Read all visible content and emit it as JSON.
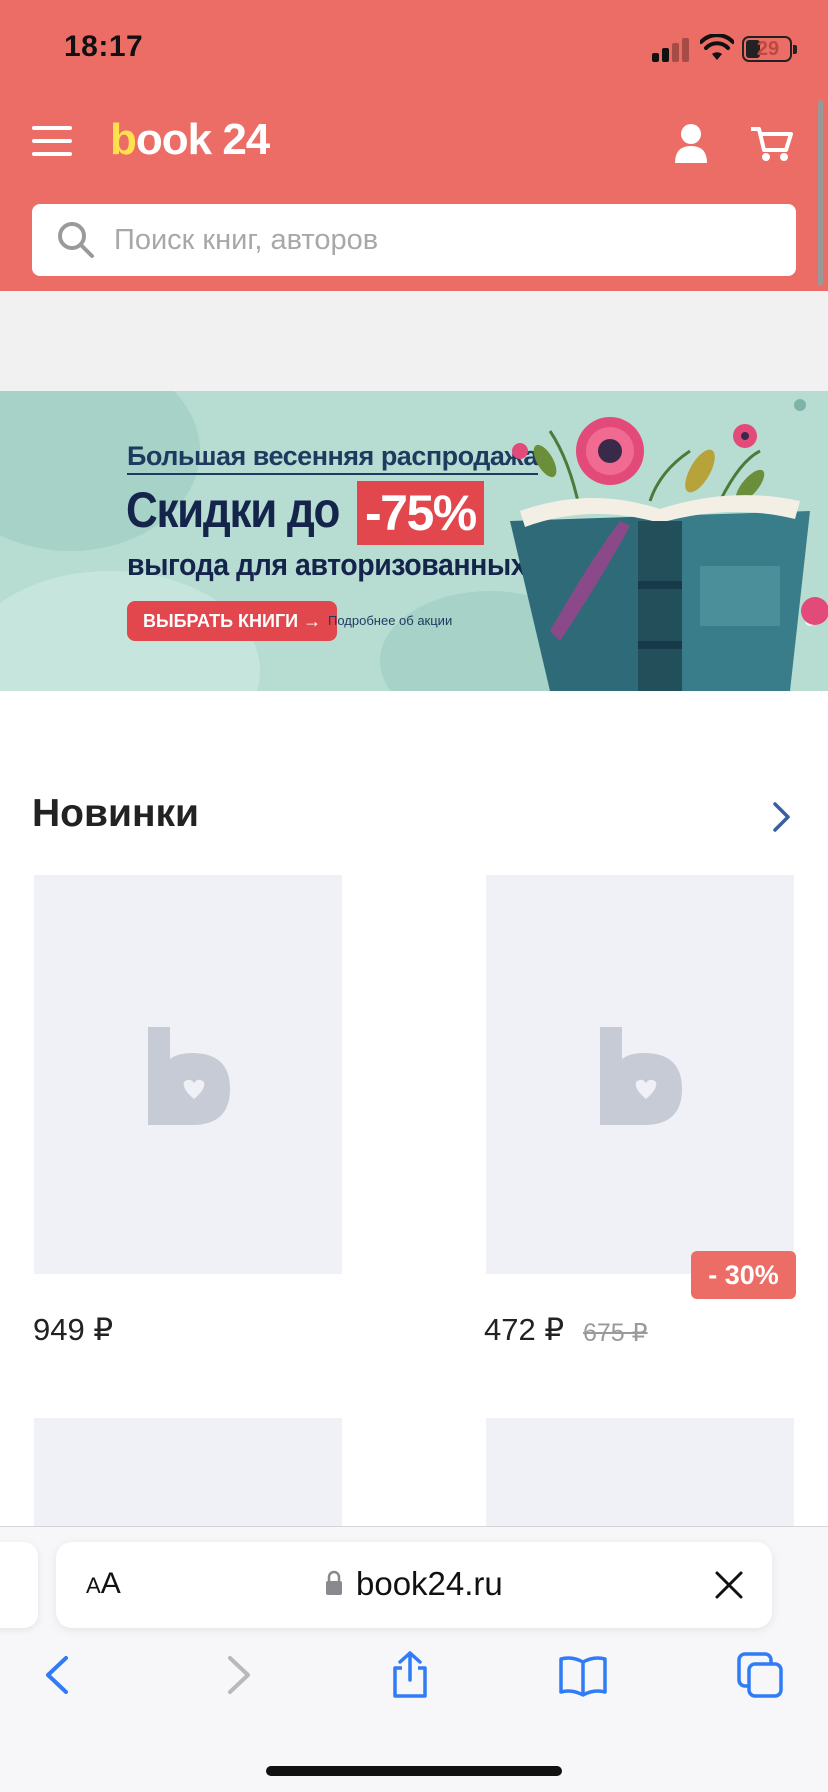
{
  "status_bar": {
    "time": "18:17",
    "battery": "29"
  },
  "header": {
    "logo_b": "b",
    "logo_rest": "ook 24",
    "search_placeholder": "Поиск книг, авторов"
  },
  "banner": {
    "line1": "Большая весенняя распродажа",
    "line2": "Скидки до",
    "discount": "-75%",
    "line3": "выгода для авторизованных",
    "button": "ВЫБРАТЬ КНИГИ →",
    "more": "Подробнее об акции"
  },
  "section": {
    "title": "Новинки",
    "products": [
      {
        "price": "949 ₽"
      },
      {
        "price": "472 ₽",
        "old_price": "675 ₽",
        "badge": "- 30%"
      }
    ]
  },
  "safari": {
    "text_size": "AA",
    "url": "book24.ru"
  },
  "colors": {
    "brand_red": "#ec6d66",
    "logo_yellow": "#ffe14d",
    "safari_blue": "#2f7cf6",
    "placeholder_bg": "#f0f1f6"
  }
}
